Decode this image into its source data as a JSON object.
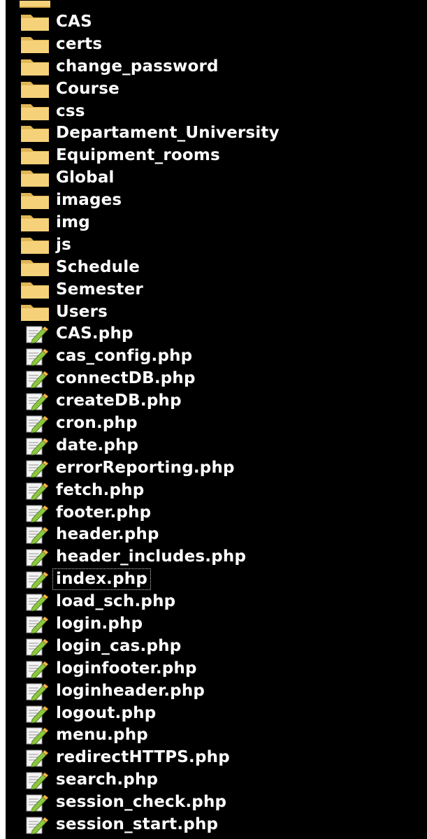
{
  "items": [
    {
      "type": "folder",
      "label": "CAS"
    },
    {
      "type": "folder",
      "label": "certs"
    },
    {
      "type": "folder",
      "label": "change_password"
    },
    {
      "type": "folder",
      "label": "Course"
    },
    {
      "type": "folder",
      "label": "css"
    },
    {
      "type": "folder",
      "label": "Departament_University"
    },
    {
      "type": "folder",
      "label": "Equipment_rooms"
    },
    {
      "type": "folder",
      "label": "Global"
    },
    {
      "type": "folder",
      "label": "images"
    },
    {
      "type": "folder",
      "label": "img"
    },
    {
      "type": "folder",
      "label": "js"
    },
    {
      "type": "folder",
      "label": "Schedule"
    },
    {
      "type": "folder",
      "label": "Semester"
    },
    {
      "type": "folder",
      "label": "Users"
    },
    {
      "type": "file",
      "label": "CAS.php"
    },
    {
      "type": "file",
      "label": "cas_config.php"
    },
    {
      "type": "file",
      "label": "connectDB.php"
    },
    {
      "type": "file",
      "label": "createDB.php"
    },
    {
      "type": "file",
      "label": "cron.php"
    },
    {
      "type": "file",
      "label": "date.php"
    },
    {
      "type": "file",
      "label": "errorReporting.php"
    },
    {
      "type": "file",
      "label": "fetch.php"
    },
    {
      "type": "file",
      "label": "footer.php"
    },
    {
      "type": "file",
      "label": "header.php"
    },
    {
      "type": "file",
      "label": "header_includes.php"
    },
    {
      "type": "file",
      "label": "index.php",
      "selected": true
    },
    {
      "type": "file",
      "label": "load_sch.php"
    },
    {
      "type": "file",
      "label": "login.php"
    },
    {
      "type": "file",
      "label": "login_cas.php"
    },
    {
      "type": "file",
      "label": "loginfooter.php"
    },
    {
      "type": "file",
      "label": "loginheader.php"
    },
    {
      "type": "file",
      "label": "logout.php"
    },
    {
      "type": "file",
      "label": "menu.php"
    },
    {
      "type": "file",
      "label": "redirectHTTPS.php"
    },
    {
      "type": "file",
      "label": "search.php"
    },
    {
      "type": "file",
      "label": "session_check.php"
    },
    {
      "type": "file",
      "label": "session_start.php"
    }
  ],
  "colors": {
    "background": "#000000",
    "text": "#ffffff",
    "folder": "#f5d27a",
    "folder_dark": "#e0b656",
    "file_page": "#f4f4f4",
    "file_pencil": "#8cc63f"
  },
  "icons": {
    "folder": "folder-icon",
    "file": "php-file-icon"
  }
}
